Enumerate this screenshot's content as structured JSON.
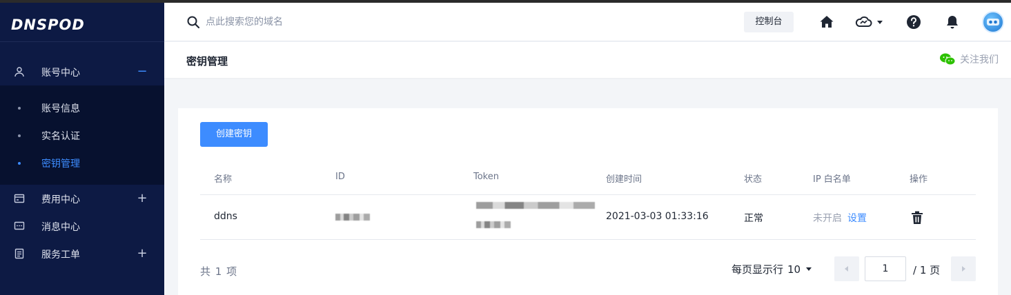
{
  "brand": {
    "logo_text": "DNSPOD",
    "accent": "#3d8cff",
    "sidebar_bg": "#0d1a44"
  },
  "header": {
    "search_placeholder": "点此搜索您的域名",
    "console_label": "控制台",
    "icons": [
      "home-icon",
      "cloud-icon",
      "help-icon",
      "bell-icon"
    ]
  },
  "sidebar": {
    "groups": [
      {
        "label": "账号中心",
        "toggle": "−",
        "icon": "user-icon"
      },
      {
        "label": "费用中心",
        "toggle": "+",
        "icon": "billing-icon"
      },
      {
        "label": "消息中心",
        "toggle": "",
        "icon": "message-icon"
      },
      {
        "label": "服务工单",
        "toggle": "+",
        "icon": "ticket-icon"
      }
    ],
    "sub_items": [
      {
        "label": "账号信息",
        "active": false
      },
      {
        "label": "实名认证",
        "active": false
      },
      {
        "label": "密钥管理",
        "active": true
      }
    ]
  },
  "page": {
    "title": "密钥管理",
    "follow_label": "关注我们"
  },
  "keys": {
    "create_label": "创建密钥",
    "columns": [
      "名称",
      "ID",
      "Token",
      "创建时间",
      "状态",
      "IP 白名单",
      "操作"
    ],
    "rows": [
      {
        "name": "ddns",
        "created": "2021-03-03 01:33:16",
        "status": "正常",
        "ip_status": "未开启",
        "ip_action": "设置"
      }
    ]
  },
  "pagination": {
    "total_text": "共 1 项",
    "per_page_label": "每页显示行",
    "per_page_value": "10",
    "current_page": "1",
    "total_pages_text": "/ 1 页"
  }
}
